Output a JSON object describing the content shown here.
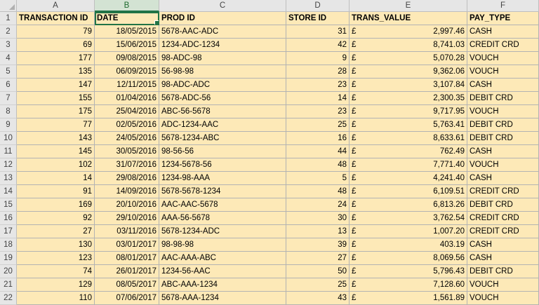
{
  "column_letters": [
    "A",
    "B",
    "C",
    "D",
    "E",
    "F"
  ],
  "selected_column": "B",
  "headers": [
    "TRANSACTION ID",
    "DATE",
    "PROD ID",
    "STORE ID",
    "TRANS_VALUE",
    "PAY_TYPE"
  ],
  "currency_symbol": "£",
  "colors": {
    "cell_fill": "#fde9b7",
    "selection": "#217346",
    "header_bg": "#e6e6e6"
  },
  "rows": [
    {
      "num": "2",
      "id": "79",
      "date": "18/05/2015",
      "prod": "5678-AAC-ADC",
      "store": "31",
      "value": "2,997.46",
      "pay": "CASH"
    },
    {
      "num": "3",
      "id": "69",
      "date": "15/06/2015",
      "prod": "1234-ADC-1234",
      "store": "42",
      "value": "8,741.03",
      "pay": "CREDIT CRD"
    },
    {
      "num": "4",
      "id": "177",
      "date": "09/08/2015",
      "prod": "98-ADC-98",
      "store": "9",
      "value": "5,070.28",
      "pay": "VOUCH"
    },
    {
      "num": "5",
      "id": "135",
      "date": "06/09/2015",
      "prod": "56-98-98",
      "store": "28",
      "value": "9,362.06",
      "pay": "VOUCH"
    },
    {
      "num": "6",
      "id": "147",
      "date": "12/11/2015",
      "prod": "98-ADC-ADC",
      "store": "23",
      "value": "3,107.84",
      "pay": "CASH"
    },
    {
      "num": "7",
      "id": "155",
      "date": "01/04/2016",
      "prod": "5678-ADC-56",
      "store": "14",
      "value": "2,300.35",
      "pay": "DEBIT CRD"
    },
    {
      "num": "8",
      "id": "175",
      "date": "25/04/2016",
      "prod": "ABC-56-5678",
      "store": "23",
      "value": "9,717.95",
      "pay": "VOUCH"
    },
    {
      "num": "9",
      "id": "77",
      "date": "02/05/2016",
      "prod": "ADC-1234-AAC",
      "store": "25",
      "value": "5,763.41",
      "pay": "DEBIT CRD"
    },
    {
      "num": "10",
      "id": "143",
      "date": "24/05/2016",
      "prod": "5678-1234-ABC",
      "store": "16",
      "value": "8,633.61",
      "pay": "DEBIT CRD"
    },
    {
      "num": "11",
      "id": "145",
      "date": "30/05/2016",
      "prod": "98-56-56",
      "store": "44",
      "value": "762.49",
      "pay": "CASH"
    },
    {
      "num": "12",
      "id": "102",
      "date": "31/07/2016",
      "prod": "1234-5678-56",
      "store": "48",
      "value": "7,771.40",
      "pay": "VOUCH"
    },
    {
      "num": "13",
      "id": "14",
      "date": "29/08/2016",
      "prod": "1234-98-AAA",
      "store": "5",
      "value": "4,241.40",
      "pay": "CASH"
    },
    {
      "num": "14",
      "id": "91",
      "date": "14/09/2016",
      "prod": "5678-5678-1234",
      "store": "48",
      "value": "6,109.51",
      "pay": "CREDIT CRD"
    },
    {
      "num": "15",
      "id": "169",
      "date": "20/10/2016",
      "prod": "AAC-AAC-5678",
      "store": "24",
      "value": "6,813.26",
      "pay": "DEBIT CRD"
    },
    {
      "num": "16",
      "id": "92",
      "date": "29/10/2016",
      "prod": "AAA-56-5678",
      "store": "30",
      "value": "3,762.54",
      "pay": "CREDIT CRD"
    },
    {
      "num": "17",
      "id": "27",
      "date": "03/11/2016",
      "prod": "5678-1234-ADC",
      "store": "13",
      "value": "1,007.20",
      "pay": "CREDIT CRD"
    },
    {
      "num": "18",
      "id": "130",
      "date": "03/01/2017",
      "prod": "98-98-98",
      "store": "39",
      "value": "403.19",
      "pay": "CASH"
    },
    {
      "num": "19",
      "id": "123",
      "date": "08/01/2017",
      "prod": "AAC-AAA-ABC",
      "store": "27",
      "value": "8,069.56",
      "pay": "CASH"
    },
    {
      "num": "20",
      "id": "74",
      "date": "26/01/2017",
      "prod": "1234-56-AAC",
      "store": "50",
      "value": "5,796.43",
      "pay": "DEBIT CRD"
    },
    {
      "num": "21",
      "id": "129",
      "date": "08/05/2017",
      "prod": "ABC-AAA-1234",
      "store": "25",
      "value": "7,128.60",
      "pay": "VOUCH"
    },
    {
      "num": "22",
      "id": "110",
      "date": "07/06/2017",
      "prod": "5678-AAA-1234",
      "store": "43",
      "value": "1,561.89",
      "pay": "VOUCH"
    }
  ]
}
